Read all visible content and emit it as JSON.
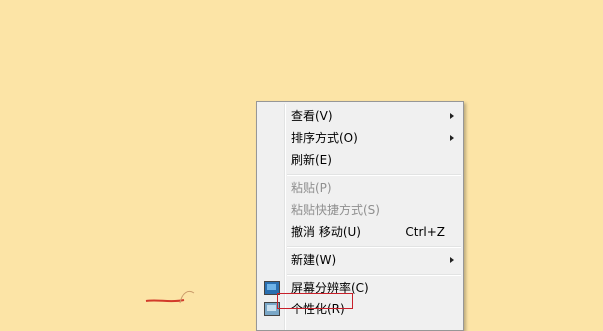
{
  "context_menu": {
    "items": [
      {
        "label": "查看(V)",
        "submenu": true,
        "disabled": false
      },
      {
        "label": "排序方式(O)",
        "submenu": true,
        "disabled": false
      },
      {
        "label": "刷新(E)",
        "submenu": false,
        "disabled": false
      },
      {
        "label": "粘贴(P)",
        "submenu": false,
        "disabled": true
      },
      {
        "label": "粘贴快捷方式(S)",
        "submenu": false,
        "disabled": true
      },
      {
        "label": "撤消 移动(U)",
        "shortcut": "Ctrl+Z",
        "submenu": false,
        "disabled": false
      },
      {
        "label": "新建(W)",
        "submenu": true,
        "disabled": false
      },
      {
        "label": "屏幕分辨率(C)",
        "icon": "display-settings-icon",
        "submenu": false,
        "disabled": false
      },
      {
        "label": "个性化(R)",
        "icon": "personalize-icon",
        "submenu": false,
        "disabled": false
      }
    ]
  },
  "colors": {
    "desktop_background": "#fce4a6",
    "menu_background": "#f0f0f0",
    "disabled_text": "#8f8f8f",
    "highlight_border": "#c8202a"
  }
}
